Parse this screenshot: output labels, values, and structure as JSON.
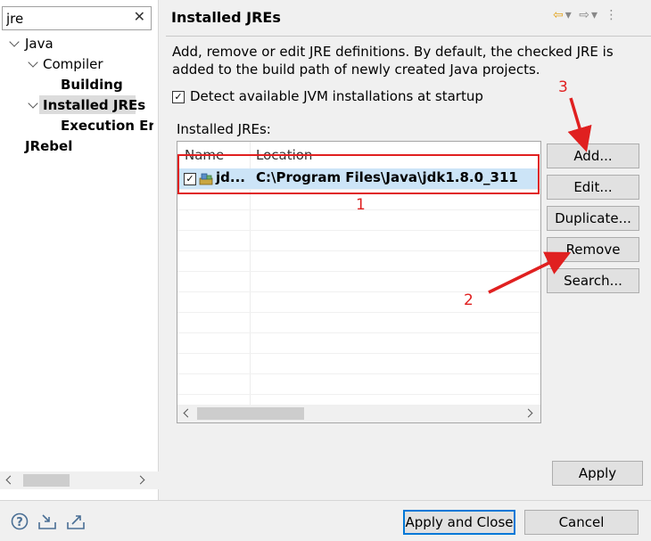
{
  "left": {
    "filter_value": "jre",
    "clear_glyph": "✕",
    "tree": [
      {
        "label": "Java"
      },
      {
        "label": "Compiler"
      },
      {
        "label": "Building"
      },
      {
        "label": "Installed JREs"
      },
      {
        "label": "Execution Env"
      },
      {
        "label": "JRebel"
      }
    ]
  },
  "header": {
    "title": "Installed JREs"
  },
  "description": "Add, remove or edit JRE definitions. By default, the checked JRE is added to the build path of newly created Java projects.",
  "detect_label": "Detect available JVM installations at startup",
  "jres_label": "Installed JREs:",
  "table": {
    "columns": [
      "Name",
      "Location"
    ],
    "rows": [
      {
        "name": "jd...",
        "location": "C:\\Program Files\\Java\\jdk1.8.0_311",
        "checked": true
      }
    ]
  },
  "buttons": {
    "add": "Add...",
    "edit": "Edit...",
    "duplicate": "Duplicate...",
    "remove": "Remove",
    "search": "Search...",
    "apply": "Apply",
    "apply_close": "Apply and Close",
    "cancel": "Cancel"
  },
  "annotations": {
    "n1": "1",
    "n2": "2",
    "n3": "3",
    "color": "#e02020"
  },
  "icons": [
    "help-icon",
    "import-icon",
    "export-icon",
    "back-arrow-icon",
    "forward-arrow-icon",
    "menu-icon"
  ],
  "accent": "#0078d7"
}
